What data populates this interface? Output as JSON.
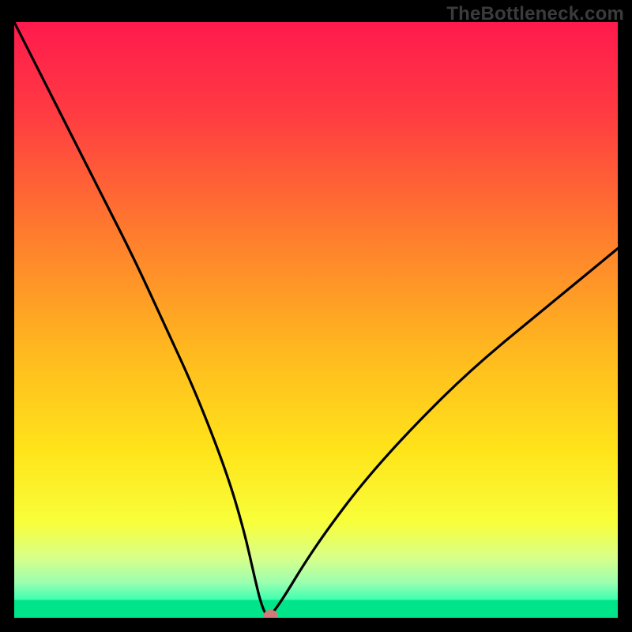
{
  "watermark": {
    "text": "TheBottleneck.com"
  },
  "chart_data": {
    "type": "line",
    "title": "",
    "xlabel": "",
    "ylabel": "",
    "xlim": [
      0,
      100
    ],
    "ylim": [
      0,
      100
    ],
    "grid": false,
    "legend": false,
    "series": [
      {
        "name": "curve",
        "x": [
          0,
          5,
          10,
          15,
          20,
          25,
          30,
          35,
          38,
          40,
          41,
          42,
          43,
          45,
          48,
          52,
          58,
          66,
          76,
          88,
          100
        ],
        "y": [
          100,
          90,
          80,
          70,
          60,
          49,
          38,
          25,
          15,
          6,
          2,
          0,
          1,
          4,
          9,
          15,
          23,
          32,
          42,
          52,
          62
        ]
      }
    ],
    "marker": {
      "x": 42.5,
      "y": 0
    },
    "gradient_stops": [
      {
        "offset": 0.0,
        "color": "#ff1a4d"
      },
      {
        "offset": 0.15,
        "color": "#ff3a42"
      },
      {
        "offset": 0.35,
        "color": "#ff7a2e"
      },
      {
        "offset": 0.55,
        "color": "#ffb81f"
      },
      {
        "offset": 0.72,
        "color": "#ffe41a"
      },
      {
        "offset": 0.84,
        "color": "#f8ff3a"
      },
      {
        "offset": 0.9,
        "color": "#d7ff8a"
      },
      {
        "offset": 0.94,
        "color": "#9dffb0"
      },
      {
        "offset": 0.97,
        "color": "#3dffb0"
      },
      {
        "offset": 1.0,
        "color": "#00e58a"
      }
    ],
    "green_band": {
      "from_y": 0,
      "to_y": 3
    }
  }
}
